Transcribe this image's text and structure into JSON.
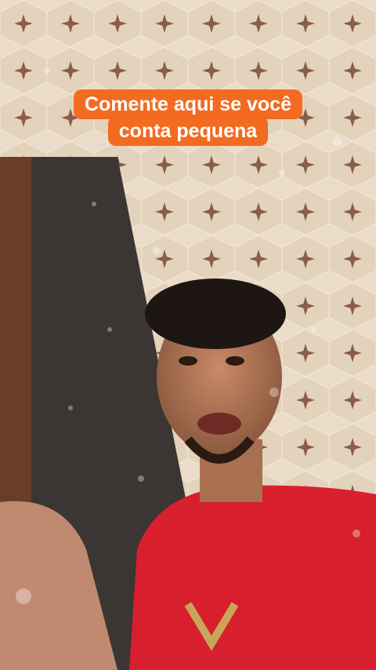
{
  "caption": {
    "line1": "Comente aqui se você",
    "line2": "conta pequena"
  },
  "colors": {
    "caption_bg": "#f26b21",
    "shirt": "#d81f2e",
    "tile": "#eadcc8",
    "doorway": "#3b3633"
  }
}
